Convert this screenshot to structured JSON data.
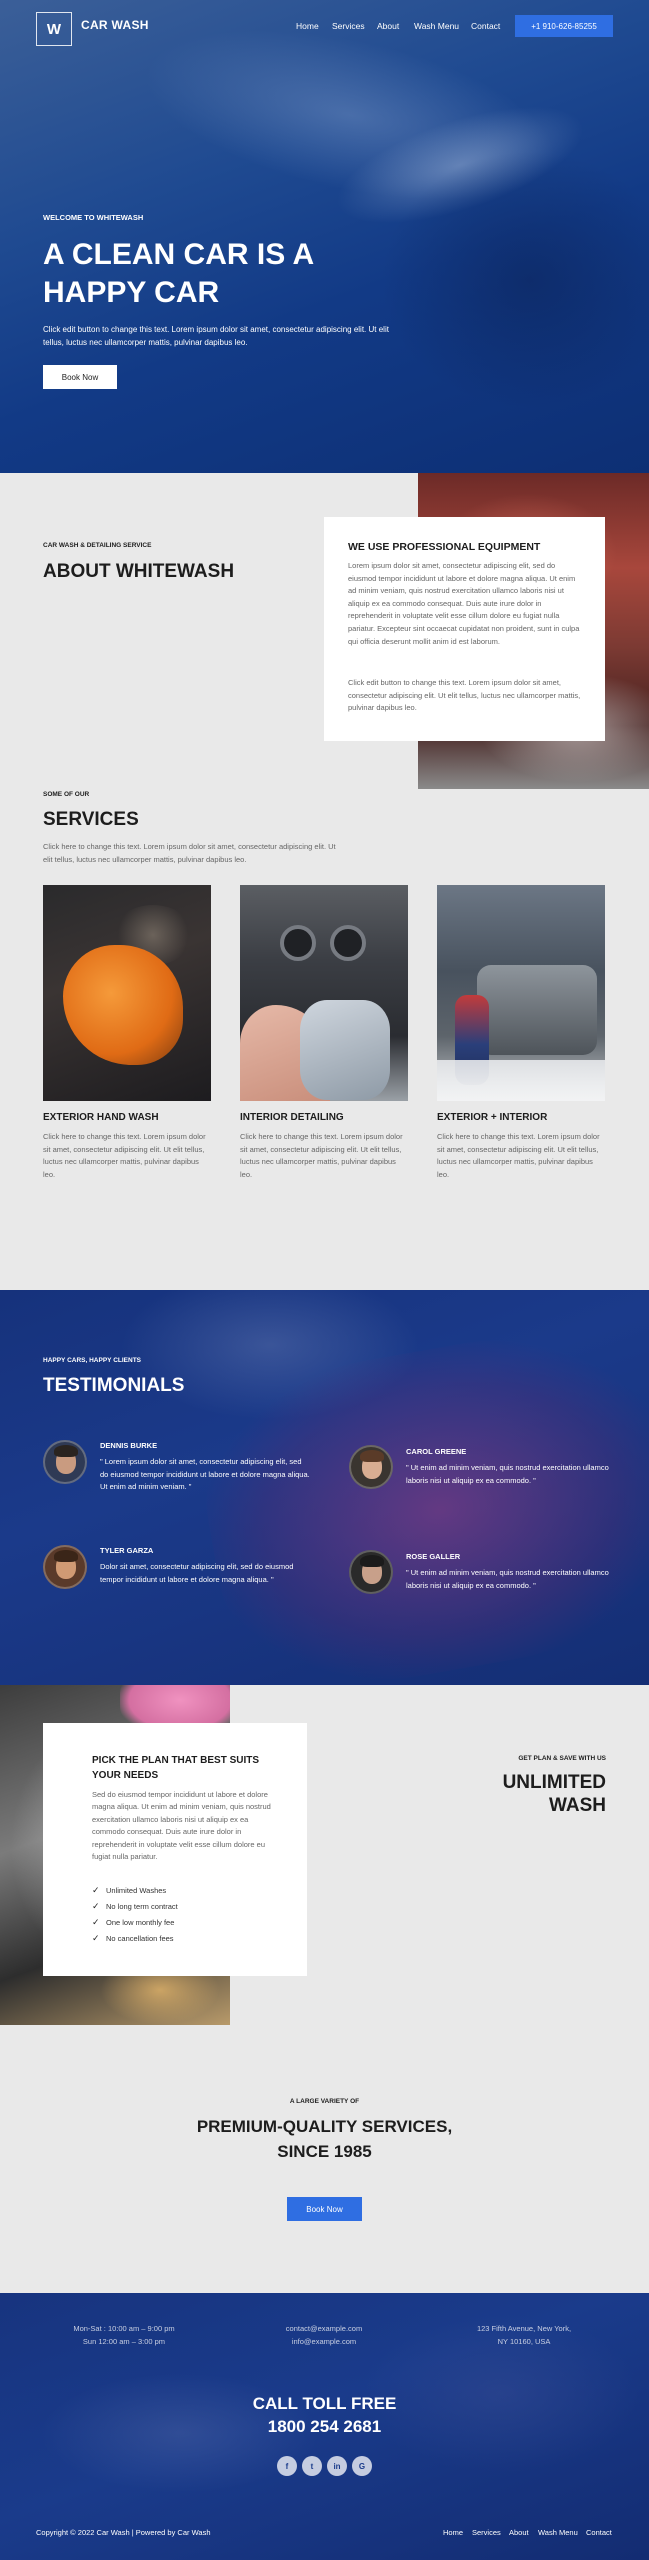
{
  "header": {
    "logo": "W",
    "brand": "CAR WASH",
    "nav": [
      "Home",
      "Services",
      "About",
      "Wash Menu",
      "Contact"
    ],
    "phone": "+1 910-626-85255"
  },
  "hero": {
    "eyebrow": "WELCOME TO WHITEWASH",
    "title": "A CLEAN CAR IS A HAPPY CAR",
    "subtitle": "Click edit button to change this text. Lorem ipsum dolor sit amet, consectetur adipiscing elit. Ut elit tellus, luctus nec ullamcorper mattis, pulvinar dapibus leo.",
    "button": "Book Now"
  },
  "about": {
    "eyebrow": "CAR WASH & DETAILING SERVICE",
    "title": "ABOUT WHITEWASH",
    "card_title": "WE USE PROFESSIONAL EQUIPMENT",
    "card_p1": "Lorem ipsum dolor sit amet, consectetur adipiscing elit, sed do eiusmod tempor incididunt ut labore et dolore magna aliqua. Ut enim ad minim veniam, quis nostrud exercitation ullamco laboris nisi ut aliquip ex ea commodo consequat. Duis aute irure dolor in reprehenderit in voluptate velit esse cillum dolore eu fugiat nulla pariatur. Excepteur sint occaecat cupidatat non proident, sunt in culpa qui officia deserunt mollit anim id est laborum.",
    "card_p2": "Click edit button to change this text. Lorem ipsum dolor sit amet, consectetur adipiscing elit. Ut elit tellus, luctus nec ullamcorper mattis, pulvinar dapibus leo."
  },
  "services": {
    "eyebrow": "SOME OF OUR",
    "title": "SERVICES",
    "subtitle": "Click here to change this text. Lorem ipsum dolor sit amet, consectetur adipiscing elit. Ut elit tellus, luctus nec ullamcorper mattis, pulvinar dapibus leo.",
    "items": [
      {
        "name": "EXTERIOR HAND WASH",
        "desc": "Click here to change this text. Lorem ipsum dolor sit amet, consectetur adipiscing elit. Ut elit tellus, luctus nec ullamcorper mattis, pulvinar dapibus leo."
      },
      {
        "name": "INTERIOR DETAILING",
        "desc": "Click here to change this text. Lorem ipsum dolor sit amet, consectetur adipiscing elit. Ut elit tellus, luctus nec ullamcorper mattis, pulvinar dapibus leo."
      },
      {
        "name": "EXTERIOR + INTERIOR",
        "desc": "Click here to change this text. Lorem ipsum dolor sit amet, consectetur adipiscing elit. Ut elit tellus, luctus nec ullamcorper mattis, pulvinar dapibus leo."
      }
    ]
  },
  "testimonials": {
    "eyebrow": "HAPPY CARS, HAPPY CLIENTS",
    "title": "TESTIMONIALS",
    "items": [
      {
        "name": "DENNIS BURKE",
        "quote": "\" Lorem ipsum dolor sit amet, consectetur adipiscing elit, sed do eiusmod tempor incididunt ut labore et dolore magna aliqua. Ut enim ad minim veniam. \""
      },
      {
        "name": "CAROL GREENE",
        "quote": "\" Ut enim ad minim veniam, quis nostrud exercitation ullamco laboris nisi ut aliquip ex ea commodo. \""
      },
      {
        "name": "TYLER GARZA",
        "quote": "Dolor sit amet, consectetur adipiscing elit, sed do eiusmod tempor incididunt ut labore et dolore magna aliqua. \""
      },
      {
        "name": "ROSE GALLER",
        "quote": "\" Ut enim ad minim veniam, quis nostrud exercitation ullamco laboris nisi ut aliquip ex ea commodo. \""
      }
    ]
  },
  "pricing": {
    "card_title": "PICK THE PLAN THAT BEST SUITS YOUR NEEDS",
    "card_desc": "Sed do eiusmod tempor incididunt ut labore et dolore magna aliqua. Ut enim ad minim veniam, quis nostrud exercitation ullamco laboris nisi ut aliquip ex ea commodo consequat. Duis aute irure dolor in reprehenderit in voluptate velit esse cillum dolore eu fugiat nulla pariatur.",
    "features": [
      "Unlimited Washes",
      "No long term contract",
      "One low monthly fee",
      "No cancellation fees"
    ],
    "eyebrow": "GET PLAN & SAVE WITH US",
    "title": "UNLIMITED WASH"
  },
  "premium": {
    "eyebrow": "A LARGE VARIETY OF",
    "title_line1": "PREMIUM-QUALITY SERVICES,",
    "title_line2": "SINCE 1985",
    "button": "Book Now"
  },
  "footer": {
    "hours_line1": "Mon-Sat : 10:00 am – 9:00 pm",
    "hours_line2": "Sun 12:00 am – 3:00 pm",
    "email_line1": "contact@example.com",
    "email_line2": "info@example.com",
    "address_line1": "123 Fifth Avenue, New York,",
    "address_line2": "NY 10160, USA",
    "toll_title": "CALL TOLL FREE",
    "toll_number": "1800 254 2681",
    "social": [
      "f",
      "t",
      "in",
      "G"
    ],
    "copyright": "Copyright © 2022 Car Wash | Powered by Car Wash",
    "nav": [
      "Home",
      "Services",
      "About",
      "Wash Menu",
      "Contact"
    ]
  },
  "colors": {
    "accent": "#2f6ee2",
    "dark_blue": "#1a3b8b",
    "section_bg": "#e9e9e9"
  }
}
